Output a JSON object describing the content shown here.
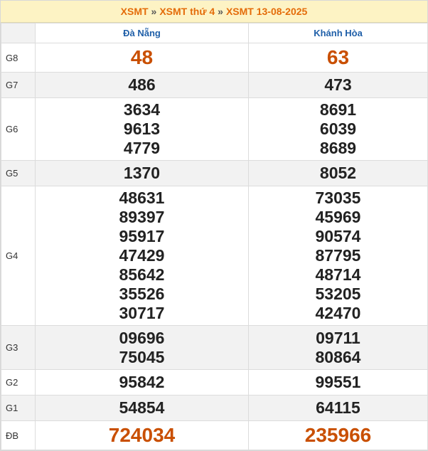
{
  "breadcrumb": {
    "item1": "XSMT",
    "item2": "XSMT thứ 4",
    "item3": "XSMT 13-08-2025",
    "separator": "»"
  },
  "provinces": [
    "Đà Nẵng",
    "Khánh Hòa"
  ],
  "prizes": [
    {
      "label": "G8",
      "values": [
        [
          "48"
        ],
        [
          "63"
        ]
      ]
    },
    {
      "label": "G7",
      "values": [
        [
          "486"
        ],
        [
          "473"
        ]
      ]
    },
    {
      "label": "G6",
      "values": [
        [
          "3634",
          "9613",
          "4779"
        ],
        [
          "8691",
          "6039",
          "8689"
        ]
      ]
    },
    {
      "label": "G5",
      "values": [
        [
          "1370"
        ],
        [
          "8052"
        ]
      ]
    },
    {
      "label": "G4",
      "values": [
        [
          "48631",
          "89397",
          "95917",
          "47429",
          "85642",
          "35526",
          "30717"
        ],
        [
          "73035",
          "45969",
          "90574",
          "87795",
          "48714",
          "53205",
          "42470"
        ]
      ]
    },
    {
      "label": "G3",
      "values": [
        [
          "09696",
          "75045"
        ],
        [
          "09711",
          "80864"
        ]
      ]
    },
    {
      "label": "G2",
      "values": [
        [
          "95842"
        ],
        [
          "99551"
        ]
      ]
    },
    {
      "label": "G1",
      "values": [
        [
          "54854"
        ],
        [
          "64115"
        ]
      ]
    },
    {
      "label": "ĐB",
      "values": [
        [
          "724034"
        ],
        [
          "235966"
        ]
      ]
    }
  ],
  "colors": {
    "accent": "#e46c0a",
    "province_header": "#1f5fa8",
    "highlight_number": "#c94f00",
    "title_bg": "#fdf3c4"
  }
}
